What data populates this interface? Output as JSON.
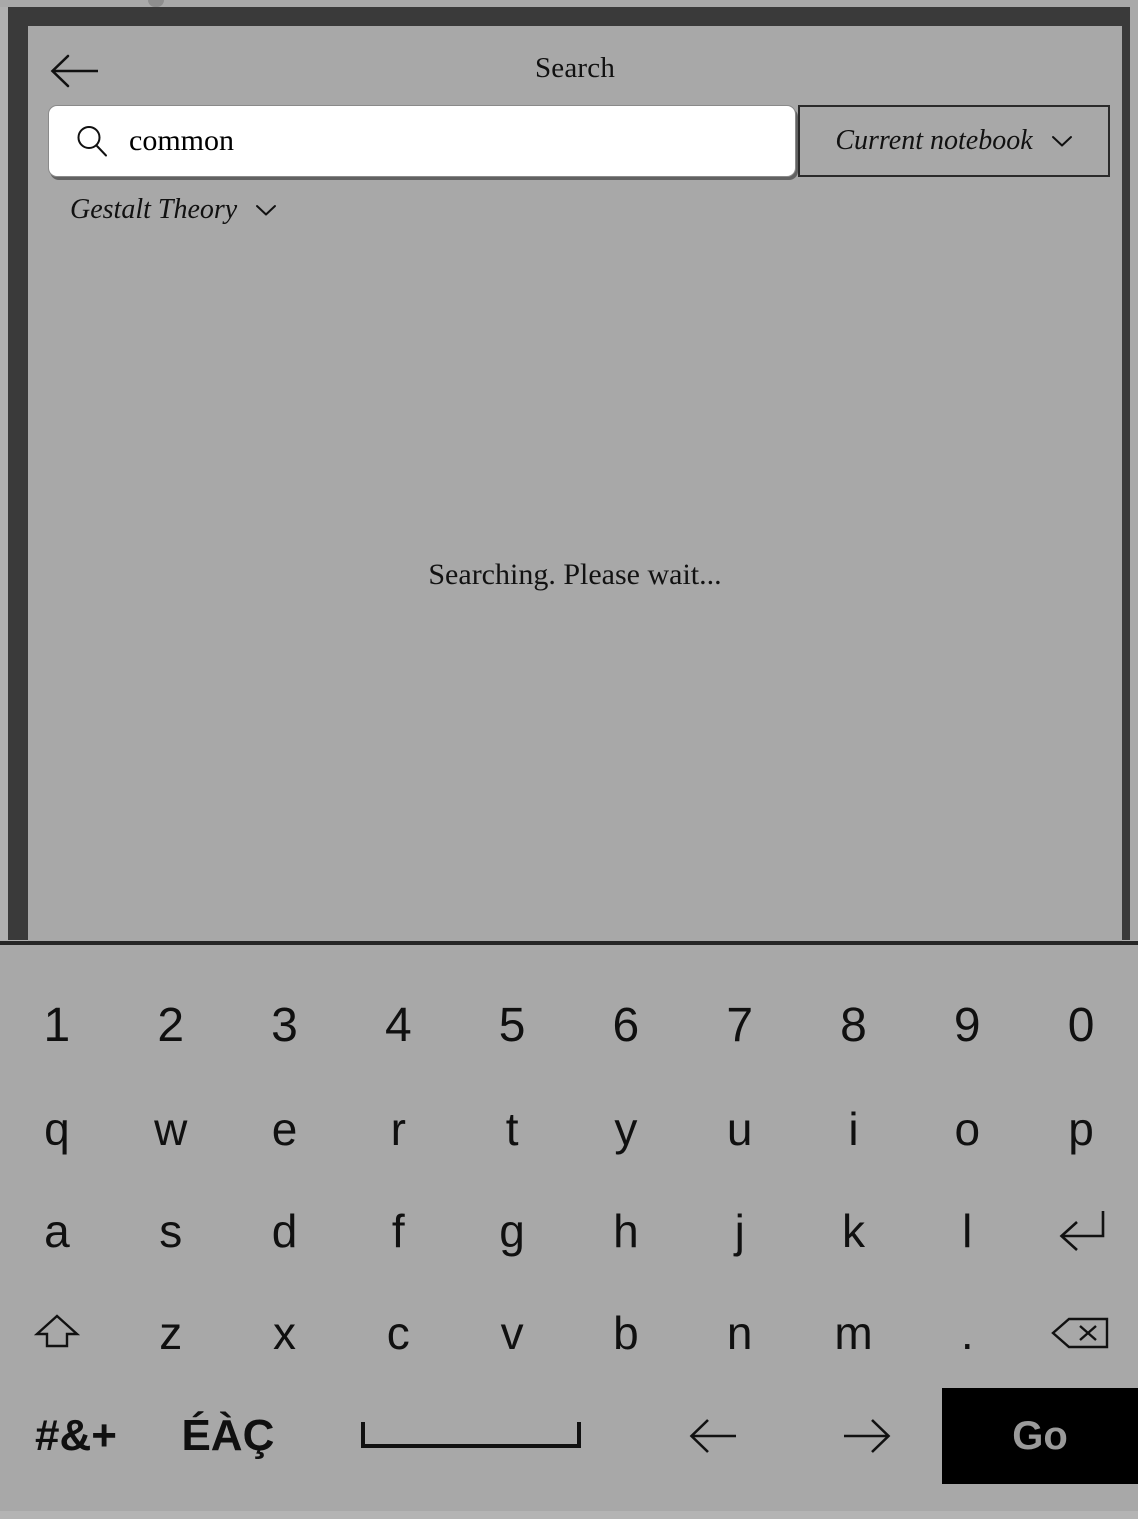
{
  "app": {
    "background_color": "#a8a8a8",
    "bezel_color": "#3a3a3a",
    "accent_color": "#000000"
  },
  "header": {
    "title": "Search",
    "back_icon": "back-arrow-icon"
  },
  "search": {
    "icon": "search-icon",
    "value": "common",
    "placeholder": "Search",
    "scope": {
      "label": "Current notebook",
      "chevron": "chevron-down-icon"
    }
  },
  "filter": {
    "notebook_label": "Gestalt Theory",
    "chevron": "chevron-down-icon"
  },
  "results": {
    "status": "Searching. Please wait...",
    "count": 0,
    "items": []
  },
  "keyboard": {
    "rows": [
      {
        "name": "numbers-row",
        "keys": [
          {
            "label": "1",
            "type": "num"
          },
          {
            "label": "2",
            "type": "num"
          },
          {
            "label": "3",
            "type": "num"
          },
          {
            "label": "4",
            "type": "num"
          },
          {
            "label": "5",
            "type": "num"
          },
          {
            "label": "6",
            "type": "num"
          },
          {
            "label": "7",
            "type": "num"
          },
          {
            "label": "8",
            "type": "num"
          },
          {
            "label": "9",
            "type": "num"
          },
          {
            "label": "0",
            "type": "num"
          }
        ]
      },
      {
        "name": "top-letter-row",
        "keys": [
          {
            "label": "q",
            "type": "letter"
          },
          {
            "label": "w",
            "type": "letter"
          },
          {
            "label": "e",
            "type": "letter"
          },
          {
            "label": "r",
            "type": "letter"
          },
          {
            "label": "t",
            "type": "letter"
          },
          {
            "label": "y",
            "type": "letter"
          },
          {
            "label": "u",
            "type": "letter"
          },
          {
            "label": "i",
            "type": "letter"
          },
          {
            "label": "o",
            "type": "letter"
          },
          {
            "label": "p",
            "type": "letter"
          }
        ]
      },
      {
        "name": "home-letter-row",
        "keys": [
          {
            "label": "a",
            "type": "letter"
          },
          {
            "label": "s",
            "type": "letter"
          },
          {
            "label": "d",
            "type": "letter"
          },
          {
            "label": "f",
            "type": "letter"
          },
          {
            "label": "g",
            "type": "letter"
          },
          {
            "label": "h",
            "type": "letter"
          },
          {
            "label": "j",
            "type": "letter"
          },
          {
            "label": "k",
            "type": "letter"
          },
          {
            "label": "l",
            "type": "letter"
          },
          {
            "label": "",
            "type": "icon",
            "icon": "enter-key-icon"
          }
        ]
      },
      {
        "name": "bottom-letter-row",
        "keys": [
          {
            "label": "",
            "type": "icon",
            "icon": "shift-key-icon"
          },
          {
            "label": "z",
            "type": "letter"
          },
          {
            "label": "x",
            "type": "letter"
          },
          {
            "label": "c",
            "type": "letter"
          },
          {
            "label": "v",
            "type": "letter"
          },
          {
            "label": "b",
            "type": "letter"
          },
          {
            "label": "n",
            "type": "letter"
          },
          {
            "label": "m",
            "type": "letter"
          },
          {
            "label": ".",
            "type": "letter"
          },
          {
            "label": "",
            "type": "icon",
            "icon": "backspace-key-icon"
          }
        ]
      },
      {
        "name": "function-row",
        "keys": [
          {
            "label": "#&+",
            "type": "sym"
          },
          {
            "label": "ÉÀÇ",
            "type": "accent"
          },
          {
            "label": "",
            "type": "icon",
            "icon": "spacebar-key-icon"
          },
          {
            "label": "",
            "type": "icon",
            "icon": "arrow-left-icon"
          },
          {
            "label": "",
            "type": "icon",
            "icon": "arrow-right-icon"
          },
          {
            "label": "Go",
            "type": "go"
          }
        ]
      }
    ],
    "go_label": "Go"
  }
}
